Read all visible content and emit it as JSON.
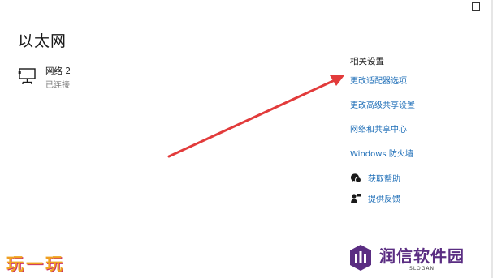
{
  "page": {
    "title": "以太网"
  },
  "network": {
    "name": "网络 2",
    "status": "已连接"
  },
  "related_settings": {
    "title": "相关设置",
    "links": [
      "更改适配器选项",
      "更改高级共享设置",
      "网络和共享中心",
      "Windows 防火墙"
    ]
  },
  "help": {
    "get_help": "获取帮助",
    "feedback": "提供反馈"
  },
  "watermarks": {
    "left_text": [
      "玩",
      "一",
      "玩"
    ],
    "right_name": "润信软件园",
    "right_slogan": "SLOGAN"
  },
  "colors": {
    "link": "#1f6fb8",
    "arrow": "#e23b3b",
    "watermark_orange": "#f0a21f",
    "watermark_purple": "#5a2d82"
  },
  "icons": {
    "network": "ethernet-monitor-icon",
    "help": "chat-help-icon",
    "feedback": "person-feedback-icon"
  }
}
